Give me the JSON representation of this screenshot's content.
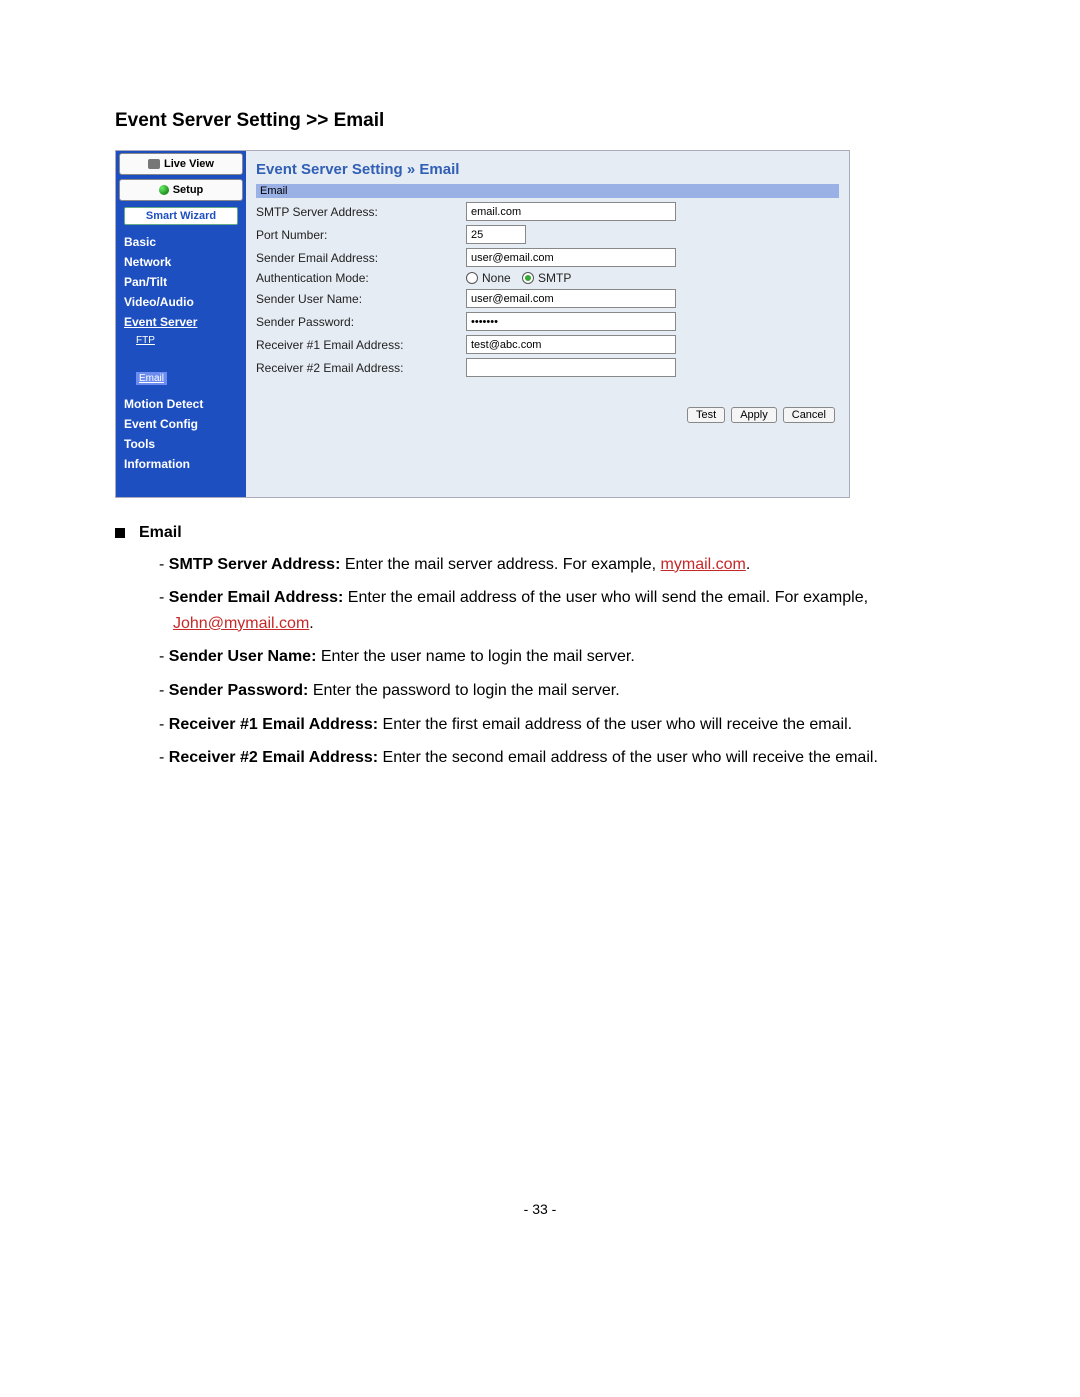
{
  "doc": {
    "heading": "Event Server Setting >> Email",
    "section_label": "Email",
    "items": [
      {
        "bold": "SMTP Server Address:",
        "text_before": " Enter the mail server address. For example, ",
        "link": "mymail.com",
        "text_after": "."
      },
      {
        "bold": "Sender Email Address:",
        "text_before": " Enter the email address of the user who will send the email. For example, ",
        "link": "John@mymail.com",
        "text_after": "."
      },
      {
        "bold": "Sender User Name:",
        "text_before": " Enter the user name to login the mail server.",
        "link": "",
        "text_after": ""
      },
      {
        "bold": "Sender Password:",
        "text_before": " Enter the password to login the mail server.",
        "link": "",
        "text_after": ""
      },
      {
        "bold": "Receiver #1 Email Address:",
        "text_before": " Enter the first email address of the user who will receive the email.",
        "link": "",
        "text_after": ""
      },
      {
        "bold": "Receiver #2 Email Address:",
        "text_before": " Enter the second email address of the user who will receive the email.",
        "link": "",
        "text_after": ""
      }
    ],
    "page_number": "- 33 -"
  },
  "ui": {
    "tabs": {
      "live": "Live View",
      "setup": "Setup"
    },
    "wizard": "Smart Wizard",
    "nav": {
      "basic": "Basic",
      "network": "Network",
      "pan_tilt": "Pan/Tilt",
      "video_audio": "Video/Audio",
      "event_server": "Event Server",
      "ftp": "FTP",
      "email": "Email",
      "motion_detect": "Motion Detect",
      "event_config": "Event Config",
      "tools": "Tools",
      "information": "Information"
    },
    "main_title": "Event Server Setting » Email",
    "section_bar": "Email",
    "labels": {
      "smtp": "SMTP Server Address:",
      "port": "Port Number:",
      "sender_email": "Sender Email Address:",
      "auth_mode": "Authentication Mode:",
      "sender_user": "Sender User Name:",
      "sender_pass": "Sender Password:",
      "recv1": "Receiver #1 Email Address:",
      "recv2": "Receiver #2 Email Address:"
    },
    "values": {
      "smtp": "email.com",
      "port": "25",
      "sender_email": "user@email.com",
      "sender_user": "user@email.com",
      "sender_pass": "•••••••",
      "recv1": "test@abc.com",
      "recv2": ""
    },
    "auth": {
      "none": "None",
      "smtp": "SMTP"
    },
    "buttons": {
      "test": "Test",
      "apply": "Apply",
      "cancel": "Cancel"
    }
  }
}
